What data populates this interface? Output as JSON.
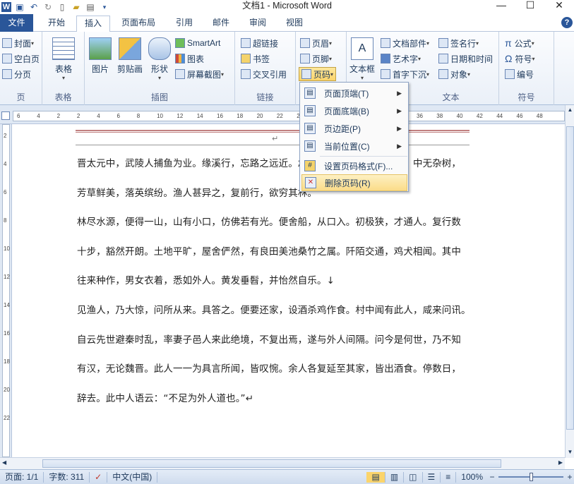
{
  "window": {
    "title": "文档1 - Microsoft Word",
    "minimize": "—",
    "maximize": "☐",
    "close": "✕"
  },
  "qat": {
    "icons": [
      "word-icon",
      "save-icon",
      "undo-icon",
      "redo-icon",
      "new-icon",
      "open-icon",
      "print-icon",
      "customize-icon"
    ]
  },
  "tabs": {
    "file": "文件",
    "items": [
      "开始",
      "插入",
      "页面布局",
      "引用",
      "邮件",
      "审阅",
      "视图"
    ],
    "active": "插入",
    "help": "?"
  },
  "ribbon": {
    "pages": {
      "label": "页",
      "cover": "封面",
      "blank": "空白页",
      "break": "分页"
    },
    "tables": {
      "label": "表格",
      "table": "表格"
    },
    "illustrations": {
      "label": "插图",
      "picture": "图片",
      "clipart": "剪贴画",
      "shapes": "形状",
      "smartart": "SmartArt",
      "chart": "图表",
      "screenshot": "屏幕截图"
    },
    "links": {
      "label": "链接",
      "hyperlink": "超链接",
      "bookmark": "书签",
      "crossref": "交叉引用"
    },
    "headerfooter": {
      "label": "页眉和页脚",
      "header": "页眉",
      "footer": "页脚",
      "pagenumber": "页码"
    },
    "text": {
      "label": "文本",
      "textbox": "文本框",
      "quickparts": "文档部件",
      "wordart": "艺术字",
      "dropcap": "首字下沉",
      "signature": "签名行",
      "datetime": "日期和时间",
      "object": "对象"
    },
    "symbols": {
      "label": "符号",
      "equation": "公式",
      "symbol": "符号",
      "number": "编号"
    }
  },
  "ruler": {
    "top_ticks": [
      "6",
      "4",
      "2",
      "2",
      "4",
      "6",
      "8",
      "10",
      "12",
      "14",
      "16",
      "18",
      "20",
      "22",
      "24",
      "26",
      "28",
      "30",
      "32",
      "34",
      "36",
      "38",
      "40",
      "42",
      "44",
      "46",
      "48"
    ],
    "left_ticks": [
      "2",
      "4",
      "6",
      "8",
      "10",
      "12",
      "14",
      "16",
      "18",
      "20",
      "22"
    ]
  },
  "document": {
    "header_mark": "↵",
    "paragraphs": [
      "晋太元中，武陵人捕鱼为业。缘溪行，忘路之远近。忽逢桃花林，夹岸数百步，中无杂树，",
      "芳草鲜美，落英缤纷。渔人甚异之，复前行，欲穷其林。",
      "林尽水源，便得一山，山有小口，仿佛若有光。便舍船，从口入。初极狭，才通人。复行数",
      "十步，豁然开朗。土地平旷，屋舍俨然，有良田美池桑竹之属。阡陌交通，鸡犬相闻。其中",
      "往来种作，男女衣着，悉如外人。黄发垂髫，并怡然自乐。↓",
      "见渔人，乃大惊，问所从来。具答之。便要还家，设酒杀鸡作食。村中闻有此人，咸来问讯。",
      "自云先世避秦时乱，率妻子邑人来此绝境，不复出焉，遂与外人间隔。问今是何世，乃不知",
      "有汉，无论魏晋。此人一一为具言所闻，皆叹惋。余人各复延至其家，皆出酒食。停数日，",
      "辞去。此中人语云：“不足为外人道也。”↵"
    ]
  },
  "menu": {
    "items": [
      {
        "label": "页面顶端(T)",
        "icon": "page-top-icon",
        "submenu": true
      },
      {
        "label": "页面底端(B)",
        "icon": "page-bottom-icon",
        "submenu": true
      },
      {
        "label": "页边距(P)",
        "icon": "page-margin-icon",
        "submenu": true
      },
      {
        "label": "当前位置(C)",
        "icon": "current-position-icon",
        "submenu": true
      },
      {
        "label": "设置页码格式(F)...",
        "icon": "format-page-number-icon",
        "submenu": false
      },
      {
        "label": "删除页码(R)",
        "icon": "delete-page-number-icon",
        "submenu": false,
        "highlighted": true
      }
    ]
  },
  "status": {
    "page": "页面: 1/1",
    "words": "字数: 311",
    "language": "中文(中国)",
    "zoom": "100%",
    "zoom_minus": "−",
    "zoom_plus": "+"
  },
  "colors": {
    "file_tab": "#2a5699",
    "highlight": "#fbdc88",
    "ribbon_bg": "#eaf0f8"
  }
}
